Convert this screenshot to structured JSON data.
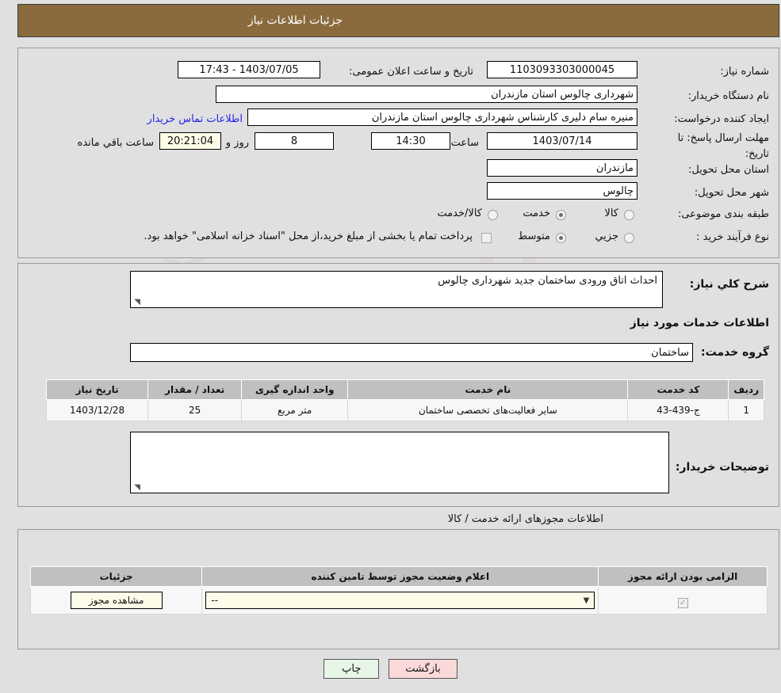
{
  "header": {
    "title": "جزئیات اطلاعات نیاز",
    "bar_color": "#8b6b3e"
  },
  "watermark": {
    "text": "AnaTender.net"
  },
  "main": {
    "need_number_label": "شماره نیاز:",
    "need_number_value": "1103093303000045",
    "announce_datetime_label": "تاریخ و ساعت اعلان عمومی:",
    "announce_datetime_value": "1403/07/05 - 17:43",
    "buyer_org_label": "نام دستگاه خریدار:",
    "buyer_org_value": "شهرداری چالوس استان مازندران",
    "creator_label": "ایجاد کننده درخواست:",
    "creator_value": "منیره سام دلیری کارشناس شهرداری چالوس استان مازندران",
    "contact_link": "اطلاعات تماس خریدار",
    "deadline_label_line1": "مهلت ارسال پاسخ: تا",
    "deadline_label_line2": "تاریخ:",
    "deadline_date": "1403/07/14",
    "hour_label": "ساعت",
    "hour_value": "14:30",
    "days_value": "8",
    "days_label": "روز و",
    "countdown_value": "20:21:04",
    "countdown_label": "ساعت باقي مانده",
    "province_label": "استان محل تحویل:",
    "province_value": "مازندران",
    "city_label": "شهر محل تحویل:",
    "city_value": "چالوس",
    "category_label": "طبقه بندی موضوعی:",
    "category_options": [
      {
        "label": "کالا",
        "selected": false
      },
      {
        "label": "خدمت",
        "selected": true
      },
      {
        "label": "کالا/خدمت",
        "selected": false
      }
    ],
    "process_label": "نوع فرآیند خرید :",
    "process_options": [
      {
        "label": "جزیي",
        "selected": false
      },
      {
        "label": "متوسط",
        "selected": true
      }
    ],
    "treasury_checkbox_checked": false,
    "treasury_text": "پرداخت تمام یا بخشی از مبلغ خرید،از محل \"اسناد خزانه اسلامی\" خواهد بود."
  },
  "detail": {
    "summary_label": "شرح کلي نیاز:",
    "summary_value": "احداث اتاق ورودی ساختمان جدید شهرداری چالوس",
    "services_info_heading": "اطلاعات خدمات مورد نیاز",
    "service_group_label": "گروه خدمت:",
    "service_group_value": "ساختمان",
    "table": {
      "columns": [
        "ردیف",
        "کد خدمت",
        "نام خدمت",
        "واحد اندازه گیری",
        "تعداد / مقدار",
        "تاریخ نیاز"
      ],
      "rows": [
        {
          "row_no": "1",
          "service_code": "ج-439-43",
          "service_name": "سایر فعالیت‌های تخصصی ساختمان",
          "unit": "متر مربع",
          "quantity": "25",
          "need_date": "1403/12/28"
        }
      ]
    },
    "buyer_notes_label": "توضیحات خریدار:",
    "buyer_notes_value": ""
  },
  "licenses": {
    "section_title": "اطلاعات مجوزهای ارائه خدمت / کالا",
    "columns": [
      "الزامی بودن ارائه مجوز",
      "اعلام وضعیت مجوز توسط تامین کننده",
      "جزئیات"
    ],
    "rows": [
      {
        "required_checked": true,
        "status_value": "--",
        "details_button": "مشاهده مجوز"
      }
    ]
  },
  "footer": {
    "print_label": "چاپ",
    "back_label": "بازگشت"
  }
}
